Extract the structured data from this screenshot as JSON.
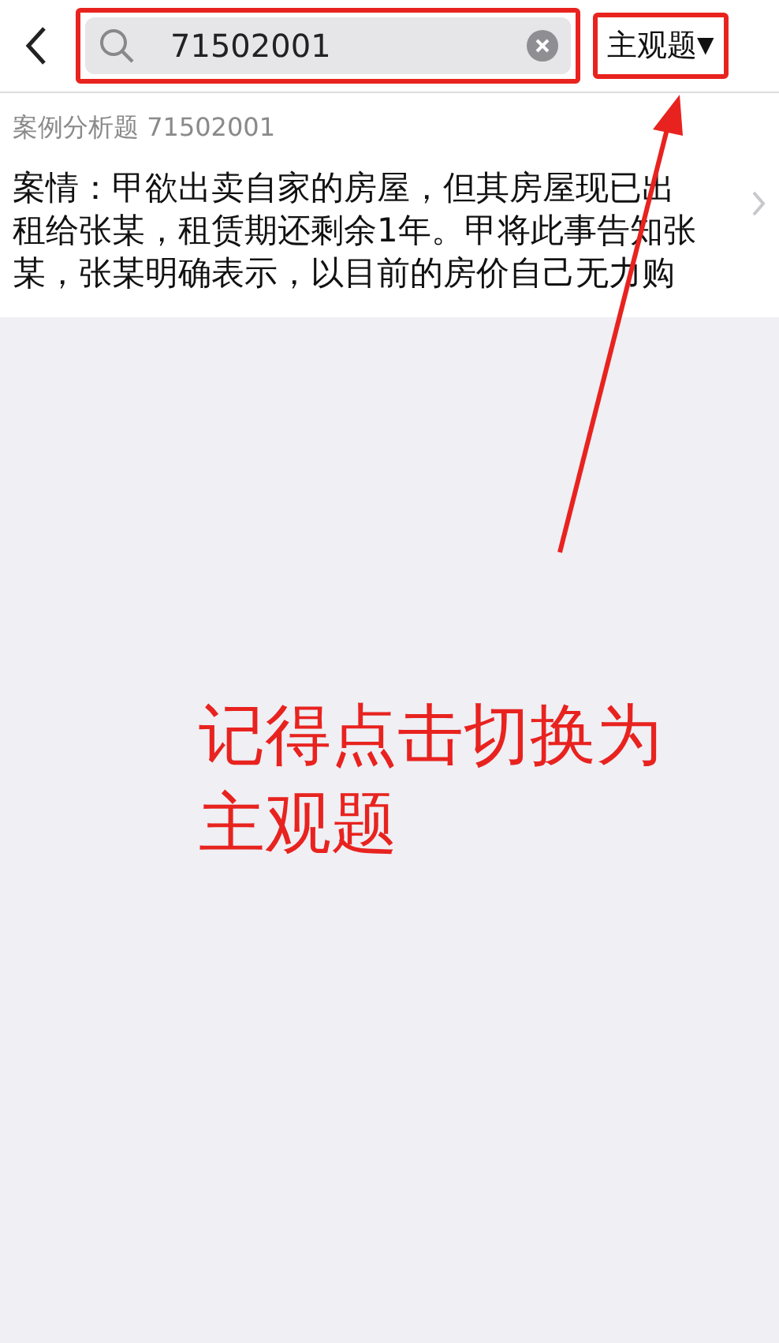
{
  "search": {
    "value": "71502001"
  },
  "type_button": {
    "label": "主观题",
    "caret": "▼"
  },
  "result": {
    "title": "案例分析题 71502001",
    "body": "案情：甲欲出卖自家的房屋，但其房屋现已出租给张某，租赁期还剩余1年。甲将此事告知张某，张某明确表示，以目前的房价自己无力购"
  },
  "annotation": {
    "lines": [
      "记得点击切换为",
      "主观题"
    ]
  }
}
